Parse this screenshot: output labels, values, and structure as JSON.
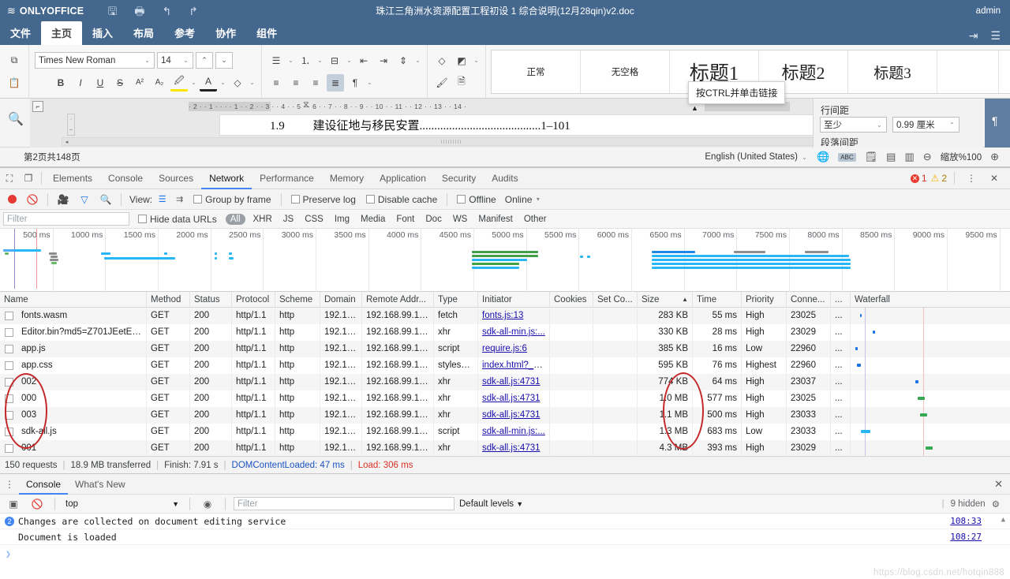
{
  "onlyoffice": {
    "brand": "ONLYOFFICE",
    "doc_title": "珠江三角洲水资源配置工程初设 1 综合说明(12月28qin)v2.doc",
    "user": "admin",
    "quick_access": [
      "save-icon",
      "print-icon",
      "undo-icon",
      "redo-icon"
    ],
    "tabs": [
      {
        "label": "文件",
        "active": false
      },
      {
        "label": "主页",
        "active": true
      },
      {
        "label": "插入",
        "active": false
      },
      {
        "label": "布局",
        "active": false
      },
      {
        "label": "参考",
        "active": false
      },
      {
        "label": "协作",
        "active": false
      },
      {
        "label": "组件",
        "active": false
      }
    ],
    "ribbon": {
      "font_name": "Times New Roman",
      "font_size": "14",
      "styles": [
        {
          "label": "正常",
          "cls": "s-normal"
        },
        {
          "label": "无空格",
          "cls": "s-normal"
        },
        {
          "label": "标题1",
          "cls": "s-h1"
        },
        {
          "label": "标题2",
          "cls": "s-h2"
        },
        {
          "label": "标题3",
          "cls": "s-h3"
        }
      ],
      "bold": "B",
      "italic": "I",
      "underline": "U",
      "strike": "S",
      "superscript": "A²",
      "subscript": "A₂"
    },
    "tooltip": "按CTRL并单击链接",
    "document": {
      "line_number": "1.9",
      "line_text": "建设征地与移民安置",
      "line_dots": ".........................................",
      "line_page": "1–101",
      "ruler_marks": "· 2 ·  · 1 ·  ·     · · 1 · · 2 · · 3 · · 4 · · 5 · · 6 · · 7 · · 8 · · 9 · · 10 · · 11 · · 12 · · 13 · · 14 ·"
    },
    "right_panel": {
      "title": "行间距",
      "select_value": "至少",
      "number_value": "0.99 厘米",
      "title2": "段落间距"
    },
    "statusbar": {
      "pages": "第2页共148页",
      "language": "English (United States)",
      "zoom": "缩放%100"
    }
  },
  "devtools": {
    "tabs": [
      {
        "label": "Elements",
        "active": false
      },
      {
        "label": "Console",
        "active": false
      },
      {
        "label": "Sources",
        "active": false
      },
      {
        "label": "Network",
        "active": true
      },
      {
        "label": "Performance",
        "active": false
      },
      {
        "label": "Memory",
        "active": false
      },
      {
        "label": "Application",
        "active": false
      },
      {
        "label": "Security",
        "active": false
      },
      {
        "label": "Audits",
        "active": false
      }
    ],
    "error_count": "1",
    "warning_count": "2",
    "toolbar": {
      "view_label": "View:",
      "group_by_frame": "Group by frame",
      "preserve_log": "Preserve log",
      "disable_cache": "Disable cache",
      "offline": "Offline",
      "online": "Online"
    },
    "filterbar": {
      "filter_placeholder": "Filter",
      "hide_data_urls": "Hide data URLs",
      "types": [
        "All",
        "XHR",
        "JS",
        "CSS",
        "Img",
        "Media",
        "Font",
        "Doc",
        "WS",
        "Manifest",
        "Other"
      ],
      "active_type": "All"
    },
    "overview": {
      "ticks": [
        "500 ms",
        "1000 ms",
        "1500 ms",
        "2000 ms",
        "2500 ms",
        "3000 ms",
        "3500 ms",
        "4000 ms",
        "4500 ms",
        "5000 ms",
        "5500 ms",
        "6000 ms",
        "6500 ms",
        "7000 ms",
        "7500 ms",
        "8000 ms",
        "8500 ms",
        "9000 ms",
        "9500 ms"
      ]
    },
    "columns": [
      "Name",
      "Method",
      "Status",
      "Protocol",
      "Scheme",
      "Domain",
      "Remote Addr...",
      "Type",
      "Initiator",
      "Cookies",
      "Set Co...",
      "Size",
      "Time",
      "Priority",
      "Conne...",
      "...",
      "Waterfall"
    ],
    "sorted_column": "Size",
    "sort_arrow": "▲",
    "rows": [
      {
        "name": "fonts.wasm",
        "method": "GET",
        "status": "200",
        "protocol": "http/1.1",
        "scheme": "http",
        "domain": "192.16...",
        "remote": "192.168.99.10...",
        "type": "fetch",
        "initiator": "fonts.js:13",
        "cookies": "",
        "setcookies": "",
        "size": "283 KB",
        "time": "55 ms",
        "priority": "High",
        "connection": "23025",
        "more": "..."
      },
      {
        "name": "Editor.bin?md5=Z701JEetE8...",
        "method": "GET",
        "status": "200",
        "protocol": "http/1.1",
        "scheme": "http",
        "domain": "192.16...",
        "remote": "192.168.99.10...",
        "type": "xhr",
        "initiator": "sdk-all-min.js:...",
        "cookies": "",
        "setcookies": "",
        "size": "330 KB",
        "time": "28 ms",
        "priority": "High",
        "connection": "23029",
        "more": "..."
      },
      {
        "name": "app.js",
        "method": "GET",
        "status": "200",
        "protocol": "http/1.1",
        "scheme": "http",
        "domain": "192.16...",
        "remote": "192.168.99.10...",
        "type": "script",
        "initiator": "require.js:6",
        "cookies": "",
        "setcookies": "",
        "size": "385 KB",
        "time": "16 ms",
        "priority": "Low",
        "connection": "22960",
        "more": "..."
      },
      {
        "name": "app.css",
        "method": "GET",
        "status": "200",
        "protocol": "http/1.1",
        "scheme": "http",
        "domain": "192.16...",
        "remote": "192.168.99.10...",
        "type": "stylesh...",
        "initiator": "index.html?_d...",
        "cookies": "",
        "setcookies": "",
        "size": "595 KB",
        "time": "76 ms",
        "priority": "Highest",
        "connection": "22960",
        "more": "..."
      },
      {
        "name": "002",
        "method": "GET",
        "status": "200",
        "protocol": "http/1.1",
        "scheme": "http",
        "domain": "192.16...",
        "remote": "192.168.99.10...",
        "type": "xhr",
        "initiator": "sdk-all.js:4731",
        "cookies": "",
        "setcookies": "",
        "size": "774 KB",
        "time": "64 ms",
        "priority": "High",
        "connection": "23037",
        "more": "..."
      },
      {
        "name": "000",
        "method": "GET",
        "status": "200",
        "protocol": "http/1.1",
        "scheme": "http",
        "domain": "192.16...",
        "remote": "192.168.99.10...",
        "type": "xhr",
        "initiator": "sdk-all.js:4731",
        "cookies": "",
        "setcookies": "",
        "size": "1.0 MB",
        "time": "577 ms",
        "priority": "High",
        "connection": "23025",
        "more": "..."
      },
      {
        "name": "003",
        "method": "GET",
        "status": "200",
        "protocol": "http/1.1",
        "scheme": "http",
        "domain": "192.16...",
        "remote": "192.168.99.10...",
        "type": "xhr",
        "initiator": "sdk-all.js:4731",
        "cookies": "",
        "setcookies": "",
        "size": "1.1 MB",
        "time": "500 ms",
        "priority": "High",
        "connection": "23033",
        "more": "..."
      },
      {
        "name": "sdk-all.js",
        "method": "GET",
        "status": "200",
        "protocol": "http/1.1",
        "scheme": "http",
        "domain": "192.16...",
        "remote": "192.168.99.10...",
        "type": "script",
        "initiator": "sdk-all-min.js:...",
        "cookies": "",
        "setcookies": "",
        "size": "1.3 MB",
        "time": "683 ms",
        "priority": "Low",
        "connection": "23033",
        "more": "..."
      },
      {
        "name": "001",
        "method": "GET",
        "status": "200",
        "protocol": "http/1.1",
        "scheme": "http",
        "domain": "192.16...",
        "remote": "192.168.99.10...",
        "type": "xhr",
        "initiator": "sdk-all.js:4731",
        "cookies": "",
        "setcookies": "",
        "size": "4.3 MB",
        "time": "393 ms",
        "priority": "High",
        "connection": "23029",
        "more": "..."
      }
    ],
    "summary": {
      "requests": "150 requests",
      "transferred": "18.9 MB transferred",
      "finish": "Finish: 7.91 s",
      "dcl": "DOMContentLoaded: 47 ms",
      "load": "Load: 306 ms"
    },
    "drawer": {
      "tabs": [
        {
          "label": "Console",
          "active": true
        },
        {
          "label": "What's New",
          "active": false
        }
      ],
      "context": "top",
      "filter_placeholder": "Filter",
      "levels": "Default levels",
      "hidden": "9 hidden",
      "messages": [
        {
          "text": "Changes are collected on document editing service",
          "location": "108:33",
          "icon": true
        },
        {
          "text": "Document is loaded",
          "location": "108:27",
          "icon": false
        }
      ]
    }
  },
  "watermark": "https://blog.csdn.net/hotqin888",
  "colors": {
    "oo_blue": "#44678e",
    "devtools_accent": "#4285f4",
    "annotation_red": "#c4282a"
  }
}
